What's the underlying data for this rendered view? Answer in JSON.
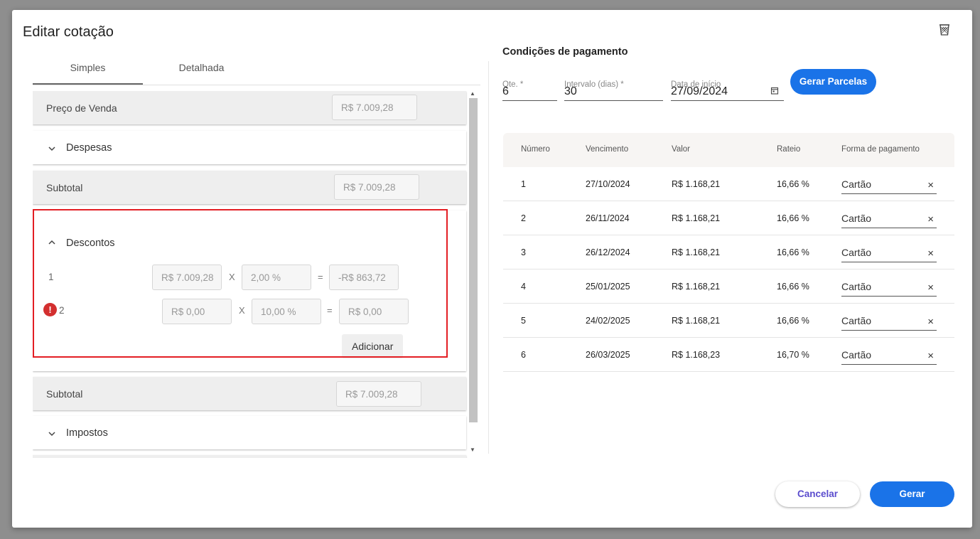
{
  "dialog": {
    "title": "Editar cotação"
  },
  "tabs": [
    {
      "label": "Simples"
    },
    {
      "label": "Detalhada"
    }
  ],
  "left": {
    "preco_venda": {
      "label": "Preço de Venda",
      "value": "R$ 7.009,28"
    },
    "despesas": {
      "label": "Despesas"
    },
    "subtotal1": {
      "label": "Subtotal",
      "value": "R$ 7.009,28"
    },
    "descontos": {
      "label": "Descontos",
      "items": [
        {
          "num": "1",
          "base": "R$ 7.009,28",
          "op": "X",
          "pct": "2,00 %",
          "eq": "=",
          "result": "-R$ 863,72"
        },
        {
          "num": "2",
          "base": "R$ 0,00",
          "op": "X",
          "pct": "10,00 %",
          "eq": "=",
          "result": "R$ 0,00"
        }
      ],
      "error_glyph": "!",
      "add_label": "Adicionar"
    },
    "subtotal2": {
      "label": "Subtotal",
      "value": "R$ 7.009,28"
    },
    "impostos": {
      "label": "Impostos"
    }
  },
  "pagamento": {
    "title": "Condições de pagamento",
    "qte": {
      "label": "Qte. *",
      "value": "6"
    },
    "intervalo": {
      "label": "Intervalo (dias) *",
      "value": "30"
    },
    "data_inicio": {
      "label": "Data de início",
      "value": "27/09/2024"
    },
    "gerar_parcelas": "Gerar Parcelas",
    "table": {
      "headers": [
        "Número",
        "Vencimento",
        "Valor",
        "Rateio",
        "Forma de pagamento"
      ],
      "rows": [
        {
          "numero": "1",
          "vencimento": "27/10/2024",
          "valor": "R$ 1.168,21",
          "rateio": "16,66 %",
          "forma": "Cartão"
        },
        {
          "numero": "2",
          "vencimento": "26/11/2024",
          "valor": "R$ 1.168,21",
          "rateio": "16,66 %",
          "forma": "Cartão"
        },
        {
          "numero": "3",
          "vencimento": "26/12/2024",
          "valor": "R$ 1.168,21",
          "rateio": "16,66 %",
          "forma": "Cartão"
        },
        {
          "numero": "4",
          "vencimento": "25/01/2025",
          "valor": "R$ 1.168,21",
          "rateio": "16,66 %",
          "forma": "Cartão"
        },
        {
          "numero": "5",
          "vencimento": "24/02/2025",
          "valor": "R$ 1.168,21",
          "rateio": "16,66 %",
          "forma": "Cartão"
        },
        {
          "numero": "6",
          "vencimento": "26/03/2025",
          "valor": "R$ 1.168,23",
          "rateio": "16,70 %",
          "forma": "Cartão"
        }
      ],
      "clear_glyph": "×"
    }
  },
  "footer": {
    "cancelar": "Cancelar",
    "gerar": "Gerar"
  },
  "colors": {
    "primary": "#1a73e8",
    "error": "#d32f2f",
    "highlight": "#e31e24",
    "cancel_text": "#5a4ccd"
  },
  "icons": [
    "trash-icon",
    "chevron-down-icon",
    "chevron-up-icon",
    "error-icon",
    "calendar-icon",
    "close-icon"
  ]
}
